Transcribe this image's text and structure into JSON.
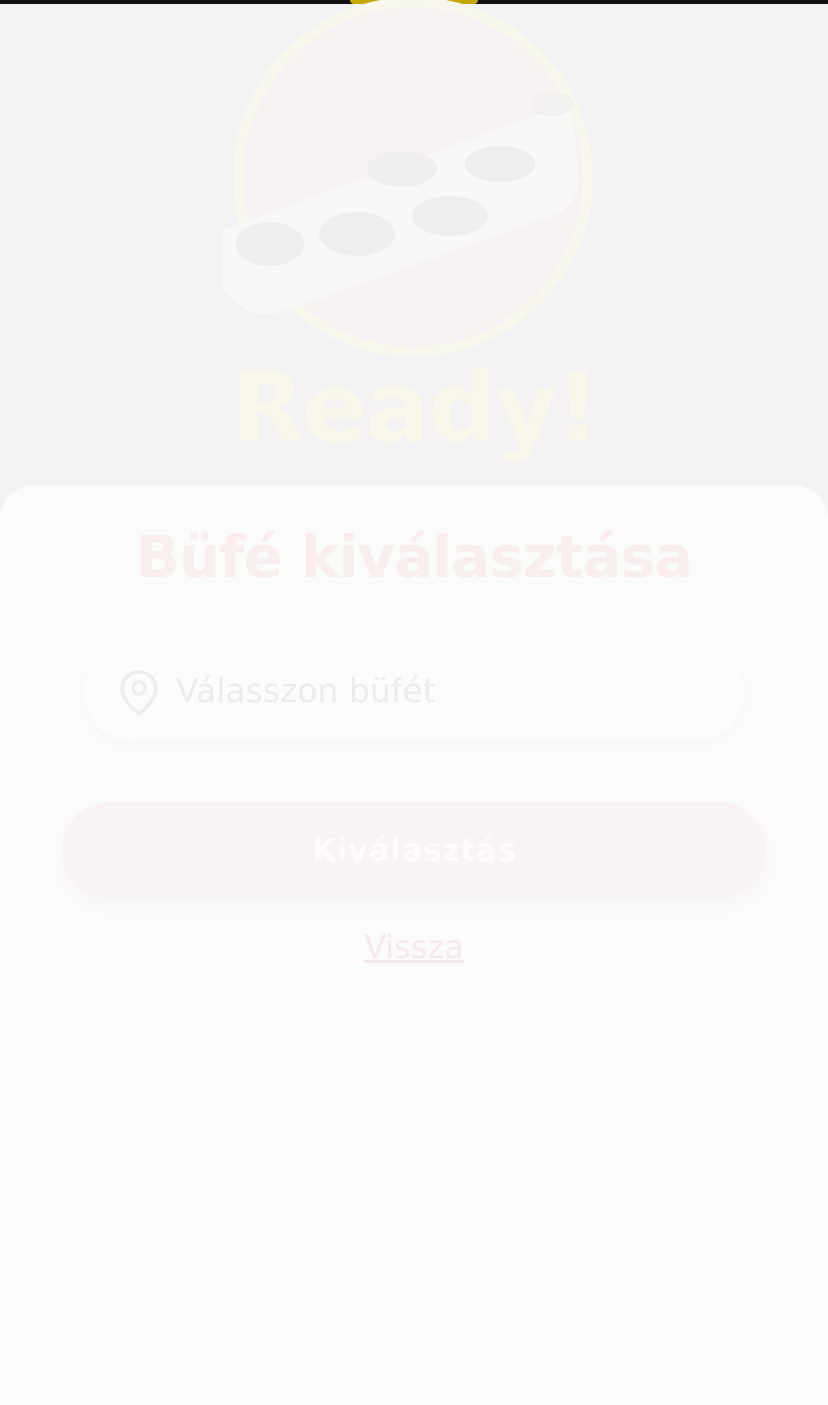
{
  "app": {
    "title": "Ready!"
  },
  "card": {
    "title": "Büfé kiválasztása",
    "select": {
      "placeholder": "Válasszon büfét",
      "icon": "location-pin-icon"
    },
    "choose_button_label": "Kiválasztás",
    "back_link_label": "Vissza"
  },
  "colors": {
    "background": "#f2f2f2",
    "card_background": "#fbfbfb",
    "title_color": "#f8eeee",
    "logo_cream": "#f8f7ea",
    "status_accent": "#c7a600"
  }
}
